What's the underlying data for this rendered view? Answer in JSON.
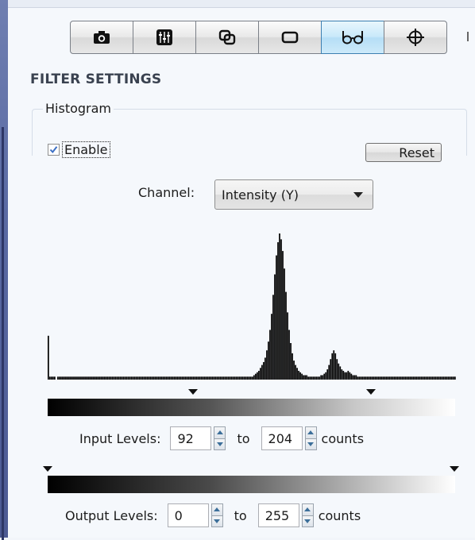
{
  "toolbar": {
    "tools": [
      {
        "icon": "camera-icon"
      },
      {
        "icon": "sliders-icon"
      },
      {
        "icon": "overlap-icon"
      },
      {
        "icon": "rectangle-icon"
      },
      {
        "icon": "glasses-icon",
        "active": true
      },
      {
        "icon": "crosshair-icon"
      }
    ]
  },
  "filter": {
    "section_title": "FILTER SETTINGS",
    "group_label": "Histogram",
    "enable_label": "Enable",
    "enable_checked": true,
    "reset_label": "Reset",
    "channel_label": "Channel:",
    "channel_value": "Intensity (Y)"
  },
  "input_levels": {
    "label": "Input Levels:",
    "min": "92",
    "to": "to",
    "max": "204",
    "unit": "counts"
  },
  "output_levels": {
    "label": "Output Levels:",
    "min": "0",
    "to": "to",
    "max": "255",
    "unit": "counts"
  },
  "chart_data": {
    "type": "bar",
    "x_range": [
      0,
      255
    ],
    "bins": [
      [
        0,
        30
      ],
      [
        1,
        2
      ],
      [
        2,
        2
      ],
      [
        3,
        2
      ],
      [
        4,
        2
      ],
      [
        6,
        2
      ],
      [
        7,
        2
      ],
      [
        8,
        2
      ],
      [
        9,
        2
      ],
      [
        10,
        2
      ],
      [
        11,
        2
      ],
      [
        12,
        2
      ],
      [
        13,
        2
      ],
      [
        14,
        2
      ],
      [
        15,
        2
      ],
      [
        16,
        2
      ],
      [
        17,
        2
      ],
      [
        18,
        2
      ],
      [
        19,
        2
      ],
      [
        20,
        2
      ],
      [
        21,
        2
      ],
      [
        22,
        2
      ],
      [
        23,
        2
      ],
      [
        24,
        2
      ],
      [
        25,
        2
      ],
      [
        26,
        2
      ],
      [
        27,
        2
      ],
      [
        28,
        2
      ],
      [
        29,
        2
      ],
      [
        30,
        2
      ],
      [
        31,
        2
      ],
      [
        32,
        2
      ],
      [
        33,
        2
      ],
      [
        34,
        2
      ],
      [
        35,
        2
      ],
      [
        36,
        2
      ],
      [
        37,
        2
      ],
      [
        38,
        2
      ],
      [
        39,
        2
      ],
      [
        40,
        2
      ],
      [
        41,
        2
      ],
      [
        42,
        2
      ],
      [
        43,
        2
      ],
      [
        44,
        2
      ],
      [
        45,
        2
      ],
      [
        46,
        2
      ],
      [
        47,
        2
      ],
      [
        48,
        2
      ],
      [
        49,
        2
      ],
      [
        50,
        2
      ],
      [
        51,
        2
      ],
      [
        52,
        2
      ],
      [
        53,
        2
      ],
      [
        54,
        2
      ],
      [
        55,
        2
      ],
      [
        56,
        2
      ],
      [
        57,
        2
      ],
      [
        58,
        2
      ],
      [
        59,
        2
      ],
      [
        60,
        2
      ],
      [
        61,
        2
      ],
      [
        62,
        2
      ],
      [
        63,
        2
      ],
      [
        64,
        2
      ],
      [
        65,
        2
      ],
      [
        66,
        2
      ],
      [
        67,
        2
      ],
      [
        68,
        2
      ],
      [
        69,
        2
      ],
      [
        70,
        2
      ],
      [
        71,
        2
      ],
      [
        72,
        2
      ],
      [
        73,
        2
      ],
      [
        74,
        2
      ],
      [
        75,
        2
      ],
      [
        76,
        2
      ],
      [
        77,
        2
      ],
      [
        78,
        2
      ],
      [
        79,
        2
      ],
      [
        80,
        2
      ],
      [
        81,
        2
      ],
      [
        82,
        2
      ],
      [
        83,
        2
      ],
      [
        84,
        2
      ],
      [
        85,
        2
      ],
      [
        86,
        2
      ],
      [
        87,
        2
      ],
      [
        88,
        2
      ],
      [
        89,
        2
      ],
      [
        90,
        2
      ],
      [
        91,
        2
      ],
      [
        92,
        2
      ],
      [
        93,
        2
      ],
      [
        94,
        2
      ],
      [
        95,
        2
      ],
      [
        96,
        2
      ],
      [
        97,
        2
      ],
      [
        98,
        2
      ],
      [
        99,
        2
      ],
      [
        100,
        2
      ],
      [
        101,
        2
      ],
      [
        102,
        2
      ],
      [
        103,
        2
      ],
      [
        104,
        2
      ],
      [
        105,
        2
      ],
      [
        106,
        2
      ],
      [
        107,
        2
      ],
      [
        108,
        2
      ],
      [
        109,
        2
      ],
      [
        110,
        2
      ],
      [
        111,
        2
      ],
      [
        112,
        2
      ],
      [
        113,
        2
      ],
      [
        114,
        2
      ],
      [
        115,
        2
      ],
      [
        116,
        2
      ],
      [
        117,
        2
      ],
      [
        118,
        2
      ],
      [
        119,
        2
      ],
      [
        120,
        2
      ],
      [
        121,
        2
      ],
      [
        122,
        2
      ],
      [
        123,
        2
      ],
      [
        124,
        2
      ],
      [
        125,
        2
      ],
      [
        126,
        2
      ],
      [
        127,
        2
      ],
      [
        128,
        2
      ],
      [
        129,
        3
      ],
      [
        130,
        4
      ],
      [
        131,
        5
      ],
      [
        132,
        6
      ],
      [
        133,
        8
      ],
      [
        134,
        10
      ],
      [
        135,
        12
      ],
      [
        136,
        15
      ],
      [
        137,
        20
      ],
      [
        138,
        26
      ],
      [
        139,
        34
      ],
      [
        140,
        45
      ],
      [
        141,
        58
      ],
      [
        142,
        72
      ],
      [
        143,
        85
      ],
      [
        144,
        94
      ],
      [
        145,
        100
      ],
      [
        146,
        96
      ],
      [
        147,
        88
      ],
      [
        148,
        76
      ],
      [
        149,
        60
      ],
      [
        150,
        46
      ],
      [
        151,
        34
      ],
      [
        152,
        25
      ],
      [
        153,
        18
      ],
      [
        154,
        13
      ],
      [
        155,
        10
      ],
      [
        156,
        8
      ],
      [
        157,
        6
      ],
      [
        158,
        5
      ],
      [
        159,
        4
      ],
      [
        160,
        3
      ],
      [
        161,
        3
      ],
      [
        162,
        3
      ],
      [
        163,
        2
      ],
      [
        164,
        2
      ],
      [
        165,
        2
      ],
      [
        166,
        2
      ],
      [
        167,
        2
      ],
      [
        168,
        2
      ],
      [
        169,
        2
      ],
      [
        170,
        2
      ],
      [
        171,
        3
      ],
      [
        172,
        3
      ],
      [
        173,
        4
      ],
      [
        174,
        5
      ],
      [
        175,
        7
      ],
      [
        176,
        10
      ],
      [
        177,
        14
      ],
      [
        178,
        18
      ],
      [
        179,
        20
      ],
      [
        180,
        18
      ],
      [
        181,
        14
      ],
      [
        182,
        11
      ],
      [
        183,
        9
      ],
      [
        184,
        7
      ],
      [
        185,
        6
      ],
      [
        186,
        5
      ],
      [
        187,
        5
      ],
      [
        188,
        6
      ],
      [
        189,
        5
      ],
      [
        190,
        4
      ],
      [
        191,
        3
      ],
      [
        192,
        3
      ],
      [
        193,
        3
      ],
      [
        194,
        2
      ],
      [
        195,
        2
      ],
      [
        196,
        2
      ],
      [
        197,
        2
      ],
      [
        198,
        2
      ],
      [
        199,
        2
      ],
      [
        200,
        2
      ],
      [
        201,
        2
      ],
      [
        202,
        2
      ],
      [
        203,
        2
      ],
      [
        204,
        2
      ],
      [
        205,
        2
      ],
      [
        206,
        2
      ],
      [
        207,
        2
      ],
      [
        208,
        2
      ],
      [
        209,
        2
      ],
      [
        210,
        2
      ],
      [
        211,
        2
      ],
      [
        212,
        2
      ],
      [
        213,
        2
      ],
      [
        214,
        2
      ],
      [
        215,
        2
      ],
      [
        216,
        2
      ],
      [
        217,
        2
      ],
      [
        218,
        2
      ],
      [
        219,
        2
      ],
      [
        220,
        2
      ],
      [
        221,
        2
      ],
      [
        222,
        2
      ],
      [
        223,
        2
      ],
      [
        224,
        2
      ],
      [
        225,
        2
      ],
      [
        226,
        2
      ],
      [
        227,
        2
      ],
      [
        228,
        2
      ],
      [
        229,
        2
      ],
      [
        230,
        2
      ],
      [
        231,
        2
      ],
      [
        232,
        2
      ],
      [
        233,
        2
      ],
      [
        234,
        2
      ],
      [
        235,
        2
      ],
      [
        236,
        2
      ],
      [
        237,
        2
      ],
      [
        238,
        2
      ],
      [
        239,
        2
      ],
      [
        240,
        2
      ],
      [
        241,
        2
      ],
      [
        242,
        2
      ],
      [
        243,
        2
      ],
      [
        244,
        2
      ],
      [
        245,
        2
      ],
      [
        246,
        2
      ],
      [
        247,
        2
      ],
      [
        248,
        2
      ],
      [
        249,
        2
      ],
      [
        250,
        2
      ],
      [
        251,
        2
      ],
      [
        252,
        2
      ],
      [
        253,
        2
      ],
      [
        254,
        2
      ],
      [
        255,
        2
      ]
    ]
  }
}
